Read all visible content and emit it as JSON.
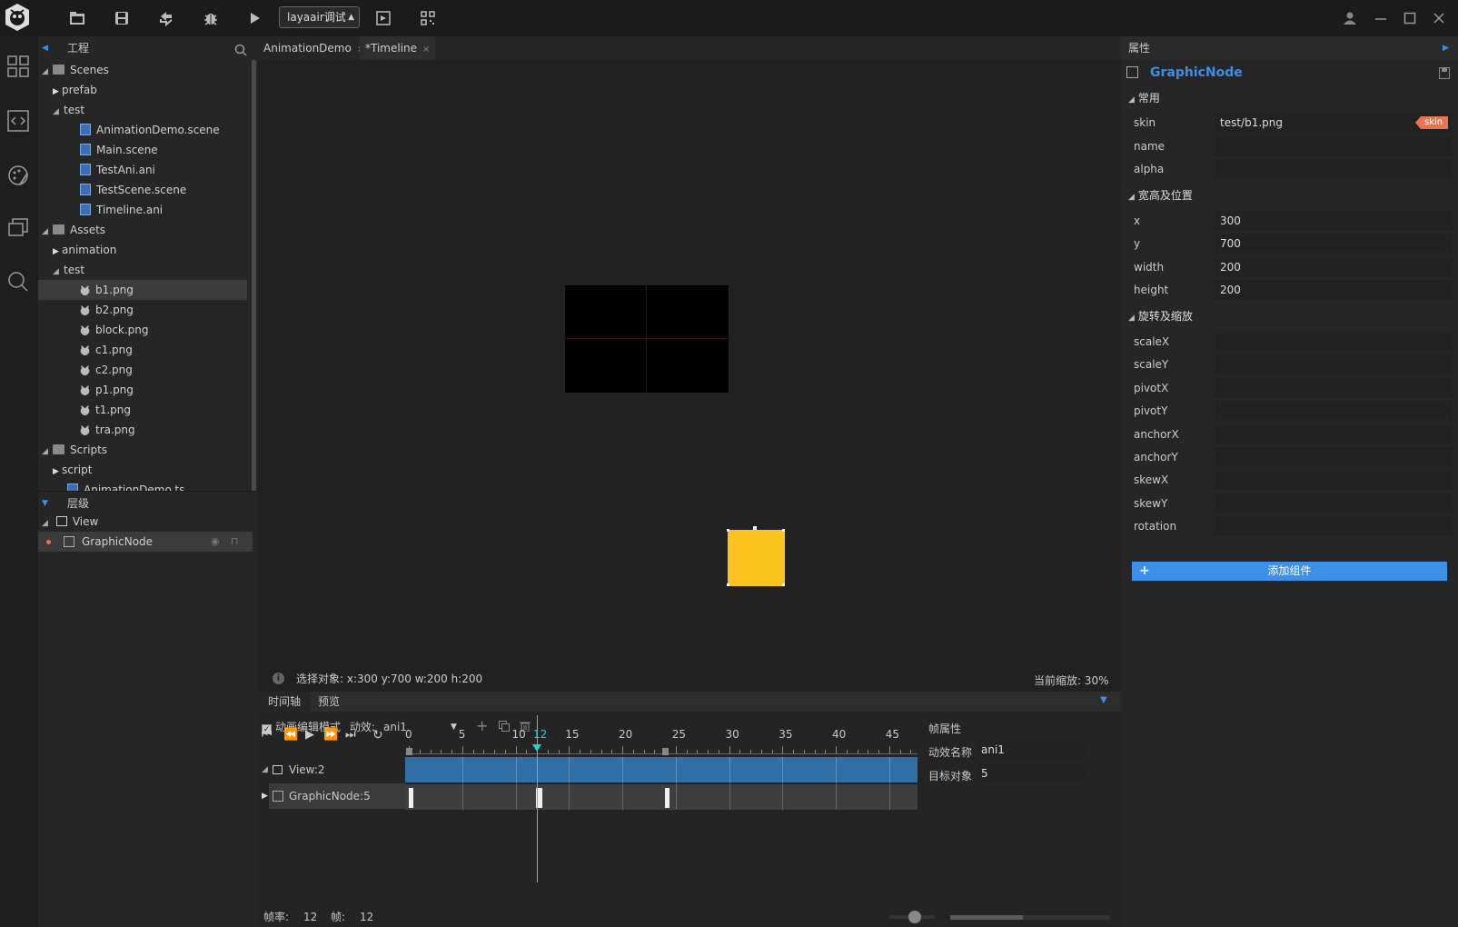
{
  "toolbar": {
    "scene_select": "layaair调试",
    "icons": [
      "app-logo-icon",
      "folder-open-icon",
      "save-icon",
      "sync-icon",
      "debug-icon",
      "play-icon",
      "browser-preview-icon",
      "qrcode-icon",
      "user-icon",
      "minimize-icon",
      "maximize-icon",
      "close-icon"
    ]
  },
  "rail": {
    "icons": [
      "grid-view-icon",
      "code-icon",
      "palette-icon",
      "layers-window-icon",
      "search-icon"
    ]
  },
  "project": {
    "title": "工程",
    "tree": [
      {
        "label": "Scenes",
        "kind": "folder",
        "depth": 0,
        "expanded": true
      },
      {
        "label": "prefab",
        "kind": "folder",
        "depth": 1,
        "expanded": false
      },
      {
        "label": "test",
        "kind": "folder",
        "depth": 1,
        "expanded": true
      },
      {
        "label": "AnimationDemo.scene",
        "kind": "file",
        "depth": 2
      },
      {
        "label": "Main.scene",
        "kind": "file",
        "depth": 2
      },
      {
        "label": "TestAni.ani",
        "kind": "file",
        "depth": 2
      },
      {
        "label": "TestScene.scene",
        "kind": "file",
        "depth": 2
      },
      {
        "label": "Timeline.ani",
        "kind": "file",
        "depth": 2
      },
      {
        "label": "Assets",
        "kind": "folder",
        "depth": 0,
        "expanded": true
      },
      {
        "label": "animation",
        "kind": "folder",
        "depth": 1,
        "expanded": false
      },
      {
        "label": "test",
        "kind": "folder",
        "depth": 1,
        "expanded": true
      },
      {
        "label": "b1.png",
        "kind": "png",
        "depth": 2,
        "selected": true
      },
      {
        "label": "b2.png",
        "kind": "png",
        "depth": 2
      },
      {
        "label": "block.png",
        "kind": "png",
        "depth": 2
      },
      {
        "label": "c1.png",
        "kind": "png",
        "depth": 2
      },
      {
        "label": "c2.png",
        "kind": "png",
        "depth": 2
      },
      {
        "label": "p1.png",
        "kind": "png",
        "depth": 2
      },
      {
        "label": "t1.png",
        "kind": "png",
        "depth": 2
      },
      {
        "label": "tra.png",
        "kind": "png",
        "depth": 2
      },
      {
        "label": "Scripts",
        "kind": "folder",
        "depth": 0,
        "expanded": true
      },
      {
        "label": "script",
        "kind": "folder",
        "depth": 1,
        "expanded": false
      },
      {
        "label": "AnimationDemo.ts",
        "kind": "file",
        "depth": 1
      }
    ]
  },
  "hierarchy": {
    "title": "层级",
    "items": [
      {
        "label": "View",
        "depth": 0
      },
      {
        "label": "GraphicNode",
        "depth": 1,
        "selected": true
      }
    ]
  },
  "tabs": [
    {
      "label": "AnimationDemo"
    },
    {
      "label": "*Timeline",
      "active": true
    }
  ],
  "status": {
    "selection": "选择对象: x:300 y:700  w:200 h:200",
    "zoom": "当前缩放: 30%"
  },
  "timeline": {
    "tab_timeline": "时间轴",
    "tab_preview": "预览",
    "edit_mode_label": "动画编辑模式",
    "edit_mode_checked": true,
    "effect_label": "动效:",
    "effect_value": "ani1",
    "ruler_labels": [
      "0",
      "5",
      "10",
      "12",
      "15",
      "20",
      "25",
      "30",
      "35",
      "40",
      "45"
    ],
    "current_frame_marker": 12,
    "tracks": [
      {
        "label": "View:2"
      },
      {
        "label": "GraphicNode:5",
        "keyframes": [
          0,
          12,
          24
        ]
      }
    ],
    "frame_rate_label": "帧率:",
    "frame_rate": "12",
    "frame_label": "帧:",
    "frame": "12",
    "frame_props": {
      "title": "帧属性",
      "name_label": "动效名称",
      "name_value": "ani1",
      "target_label": "目标对象",
      "target_value": "5"
    }
  },
  "props": {
    "title": "属性",
    "node_name": "GraphicNode",
    "group_common": "常用",
    "skin_label": "skin",
    "skin_value": "test/b1.png",
    "skin_tag": "skin",
    "name_label": "name",
    "alpha_label": "alpha",
    "group_size": "宽高及位置",
    "x_label": "x",
    "x_value": "300",
    "y_label": "y",
    "y_value": "700",
    "width_label": "width",
    "width_value": "200",
    "height_label": "height",
    "height_value": "200",
    "group_rotate": "旋转及缩放",
    "scaleX_label": "scaleX",
    "scaleY_label": "scaleY",
    "pivotX_label": "pivotX",
    "pivotY_label": "pivotY",
    "anchorX_label": "anchorX",
    "anchorY_label": "anchorY",
    "skewX_label": "skewX",
    "skewY_label": "skewY",
    "rotation_label": "rotation",
    "add_component": "添加组件"
  },
  "colors": {
    "accent": "#3d8fe8",
    "node_fill": "#fcc21f",
    "track_blue": "#2f6fa5",
    "playhead": "#1fd2d8",
    "skin_tag": "#e8734f"
  }
}
